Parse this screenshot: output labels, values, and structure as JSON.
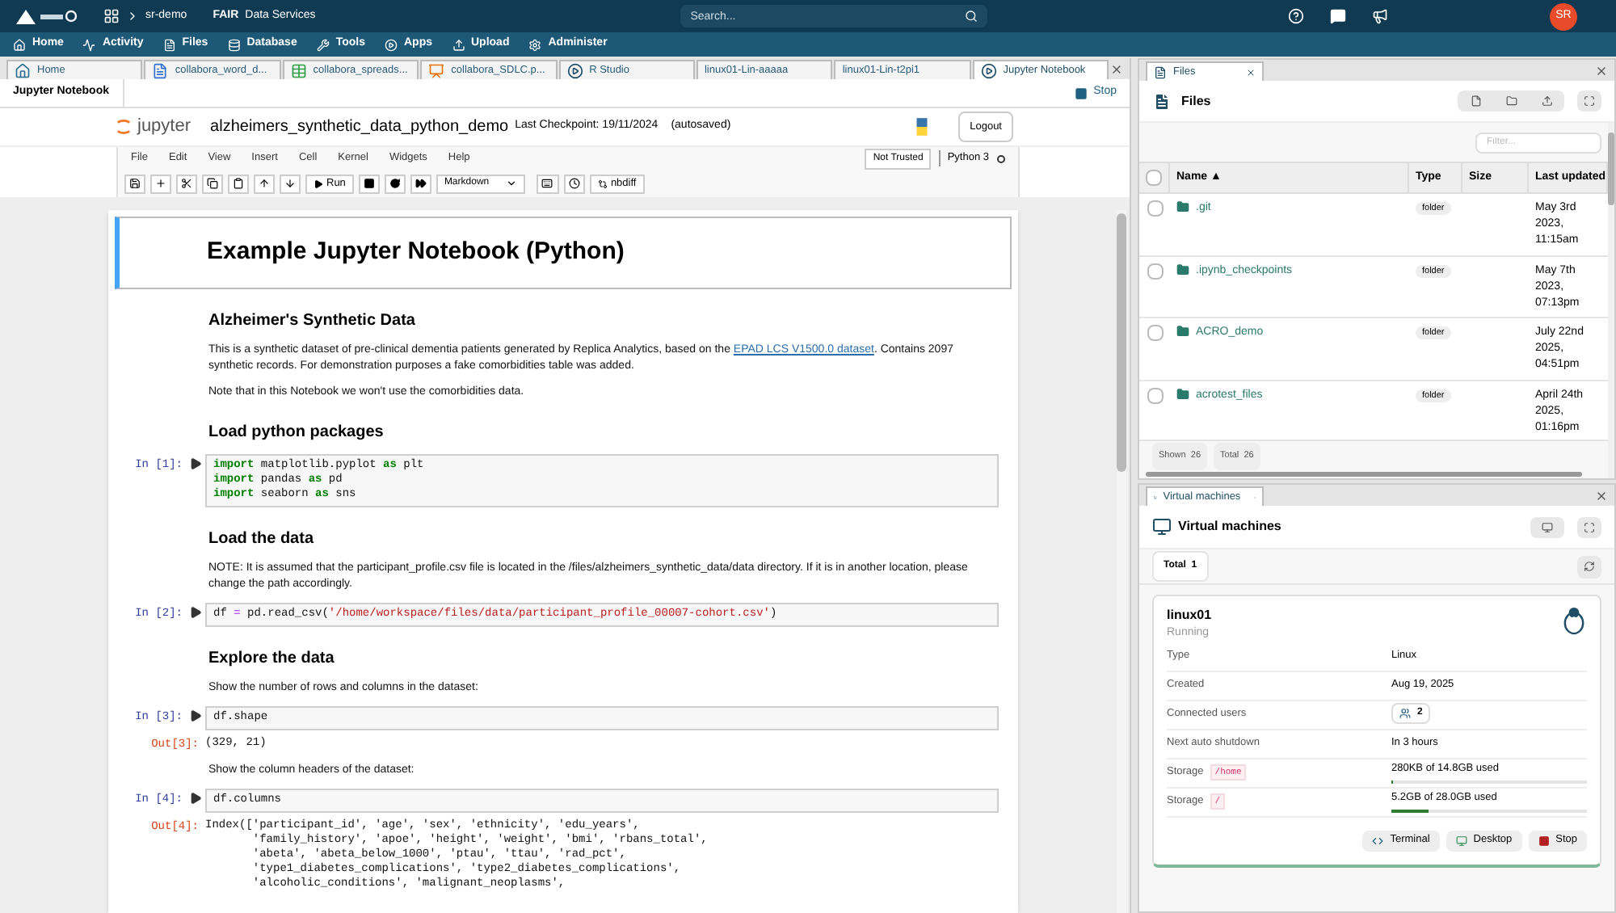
{
  "topbar": {
    "workspace": "sr-demo",
    "brand": "FAIR",
    "service": "Data Services",
    "search_placeholder": "Search...",
    "avatar": "SR"
  },
  "nav": [
    {
      "label": "Home",
      "kind": "home"
    },
    {
      "label": "Activity",
      "kind": "activity"
    },
    {
      "label": "Files",
      "kind": "files"
    },
    {
      "label": "Database",
      "kind": "database"
    },
    {
      "label": "Tools",
      "kind": "tools"
    },
    {
      "label": "Apps",
      "kind": "apps"
    },
    {
      "label": "Upload",
      "kind": "upload"
    },
    {
      "label": "Administer",
      "kind": "admin"
    }
  ],
  "tabs": [
    {
      "label": "Home",
      "kind": "home",
      "selected": false
    },
    {
      "label": "collabora_word_d...",
      "kind": "doc",
      "selected": false
    },
    {
      "label": "collabora_spreads...",
      "kind": "sheet",
      "selected": false
    },
    {
      "label": "collabora_SDLC.p...",
      "kind": "slides",
      "selected": false
    },
    {
      "label": "R Studio",
      "kind": "app",
      "selected": false
    },
    {
      "label": "linux01-Lin-aaaaa",
      "kind": "plain",
      "selected": false
    },
    {
      "label": "linux01-Lin-t2pi1",
      "kind": "plain",
      "selected": false
    },
    {
      "label": "Jupyter Notebook",
      "kind": "app",
      "selected": true
    }
  ],
  "notebook_panel": {
    "title": "Jupyter Notebook",
    "stop": "Stop",
    "jupyter": {
      "brand": "jupyter",
      "name": "alzheimers_synthetic_data_python_demo",
      "checkpoint": "Last Checkpoint: 19/11/2024",
      "autosaved": "(autosaved)",
      "logout": "Logout",
      "menu": [
        "File",
        "Edit",
        "View",
        "Insert",
        "Cell",
        "Kernel",
        "Widgets",
        "Help"
      ],
      "not_trusted": "Not Trusted",
      "kernel": "Python 3",
      "run": "Run",
      "cell_type": "Markdown",
      "nbdiff": "nbdiff"
    },
    "cells": [
      {
        "kind": "title",
        "text": "Example Jupyter Notebook (Python)"
      },
      {
        "kind": "heading",
        "text": "Alzheimer's Synthetic Data"
      },
      {
        "kind": "paragraph",
        "parts": [
          {
            "text": "This is a synthetic dataset of pre-clinical dementia patients generated by Replica Analytics, based on the "
          },
          {
            "text": "EPAD LCS V1500.0 dataset",
            "link": true
          },
          {
            "text": ". Contains 2097 synthetic records. For demonstration purposes a fake comorbidities table was added."
          }
        ]
      },
      {
        "kind": "paragraph",
        "parts": [
          {
            "text": "Note that in this Notebook we won't use the comorbidities data."
          }
        ]
      },
      {
        "kind": "heading",
        "text": "Load python packages"
      },
      {
        "kind": "code",
        "prompt": "In [1]:",
        "lines": [
          [
            {
              "t": "import",
              "kind": "keyword"
            },
            {
              "t": " matplotlib.pyplot ",
              "kind": "plain"
            },
            {
              "t": "as",
              "kind": "keyword"
            },
            {
              "t": " plt",
              "kind": "plain"
            }
          ],
          [
            {
              "t": "import",
              "kind": "keyword"
            },
            {
              "t": " pandas ",
              "kind": "plain"
            },
            {
              "t": "as",
              "kind": "keyword"
            },
            {
              "t": " pd",
              "kind": "plain"
            }
          ],
          [
            {
              "t": "import",
              "kind": "keyword"
            },
            {
              "t": " seaborn ",
              "kind": "plain"
            },
            {
              "t": "as",
              "kind": "keyword"
            },
            {
              "t": " sns",
              "kind": "plain"
            }
          ]
        ]
      },
      {
        "kind": "heading",
        "text": "Load the data"
      },
      {
        "kind": "paragraph",
        "parts": [
          {
            "text": "NOTE: It is assumed that the participant_profile.csv file is located in the /files/alzheimers_synthetic_data/data directory. If it is in another location, please change the path accordingly."
          }
        ]
      },
      {
        "kind": "code",
        "prompt": "In [2]:",
        "lines": [
          [
            {
              "t": "df ",
              "kind": "plain"
            },
            {
              "t": "=",
              "kind": "operator"
            },
            {
              "t": " pd.read_csv(",
              "kind": "plain"
            },
            {
              "t": "'/home/workspace/files/data/participant_profile_00007-cohort.csv'",
              "kind": "string"
            },
            {
              "t": ")",
              "kind": "plain"
            }
          ]
        ]
      },
      {
        "kind": "heading",
        "text": "Explore the data"
      },
      {
        "kind": "paragraph",
        "parts": [
          {
            "text": "Show the number of rows and columns in the dataset:"
          }
        ]
      },
      {
        "kind": "code",
        "prompt": "In [3]:",
        "lines": [
          [
            {
              "t": "df.shape",
              "kind": "plain"
            }
          ]
        ],
        "out_prompt": "Out[3]:",
        "output": [
          "(329, 21)"
        ]
      },
      {
        "kind": "paragraph",
        "parts": [
          {
            "text": "Show the column headers of the dataset:"
          }
        ]
      },
      {
        "kind": "code",
        "prompt": "In [4]:",
        "lines": [
          [
            {
              "t": "df.columns",
              "kind": "plain"
            }
          ]
        ],
        "out_prompt": "Out[4]:",
        "output": [
          "Index(['participant_id', 'age', 'sex', 'ethnicity', 'edu_years',",
          "       'family_history', 'apoe', 'height', 'weight', 'bmi', 'rbans_total',",
          "       'abeta', 'abeta_below_1000', 'ptau', 'ttau', 'rad_pct',",
          "       'type1_diabetes_complications', 'type2_diabetes_complications',",
          "       'alcoholic_conditions', 'malignant_neoplasms',"
        ]
      }
    ]
  },
  "files_panel": {
    "tab": "Files",
    "title": "Files",
    "filter_placeholder": "Filter...",
    "columns": [
      "Name ▲",
      "Type",
      "Size",
      "Last updated"
    ],
    "all_checked": false,
    "rows": [
      {
        "name": ".git",
        "type": "folder",
        "updated": "May 3rd 2023, 11:15am",
        "checked": false
      },
      {
        "name": ".ipynb_checkpoints",
        "type": "folder",
        "updated": "May 7th 2023, 07:13pm",
        "checked": false
      },
      {
        "name": "ACRO_demo",
        "type": "folder",
        "updated": "July 22nd 2025, 04:51pm",
        "checked": false
      },
      {
        "name": "acrotest_files",
        "type": "folder",
        "updated": "April 24th 2025, 01:16pm",
        "checked": false
      }
    ],
    "shown_label": "Shown",
    "shown": "26",
    "total_label": "Total",
    "total": "26"
  },
  "vm_panel": {
    "tab": "Virtual machines",
    "title": "Virtual machines",
    "total_label": "Total",
    "total": "1",
    "vm": {
      "name": "linux01",
      "status": "Running",
      "rows": [
        {
          "kind": "text",
          "label": "Type",
          "value": "Linux"
        },
        {
          "kind": "text",
          "label": "Created",
          "value": "Aug 19, 2025"
        },
        {
          "kind": "users",
          "label": "Connected users",
          "value": "2"
        },
        {
          "kind": "text",
          "label": "Next auto shutdown",
          "value": "In 3 hours"
        },
        {
          "kind": "storage",
          "label": "Storage",
          "path": "/home",
          "value": "280KB of 14.8GB used",
          "level": 0.01
        },
        {
          "kind": "storage",
          "label": "Storage",
          "path": "/",
          "value": "5.2GB of 28.0GB used",
          "level": 0.19
        }
      ],
      "buttons": [
        {
          "label": "Terminal",
          "kind": "terminal"
        },
        {
          "label": "Desktop",
          "kind": "desktop"
        },
        {
          "label": "Stop",
          "kind": "stop"
        }
      ]
    }
  }
}
